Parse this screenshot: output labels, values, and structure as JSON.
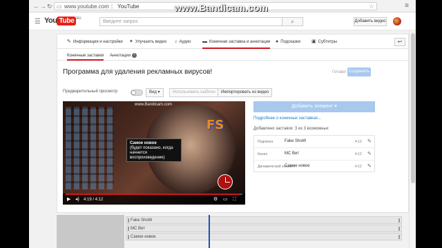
{
  "watermark": "www.Bandicam.com",
  "browser": {
    "url": "www.youtube.com",
    "page_title": "YouTube"
  },
  "header": {
    "logo_you": "You",
    "logo_tube": "Tube",
    "logo_region": "RU",
    "search_placeholder": "Введите запрос",
    "upload_label": "Добавить видео"
  },
  "tabs": [
    {
      "label": "Информация и настройки",
      "icon": "pencil-icon"
    },
    {
      "label": "Улучшить видео",
      "icon": "magic-wand-icon"
    },
    {
      "label": "Аудио",
      "icon": "music-note-icon"
    },
    {
      "label": "Конечная заставка и аннотации",
      "icon": "end-screen-icon",
      "active": true
    },
    {
      "label": "Подсказки",
      "icon": "info-icon"
    },
    {
      "label": "Субтитры",
      "icon": "subtitles-icon"
    }
  ],
  "subtabs": [
    {
      "label": "Конечные заставки",
      "active": true
    },
    {
      "label": "Аннотации",
      "badge": "!"
    }
  ],
  "video_title": "Программа для удаления рекламных вирусов!",
  "status_ready": "Готово!",
  "save_label": "Сохранить",
  "toolbar": {
    "preview_label": "Предварительный просмотр",
    "view_label": "Вид ▾",
    "template_label": "Использовать шаблон",
    "import_label": "Импортировать из видео"
  },
  "video": {
    "watermark": "www.Bandicam.com",
    "tooltip_title": "Самое новое",
    "tooltip_text": "(будет показано, когда начнется воспроизведение)",
    "logo_text": "FS",
    "time": "4:19 / 4:12",
    "progress": 0.98
  },
  "add_element_label": "Добавить элемент ▾",
  "more_link": "Подробнее о конечных заставках...",
  "added_count": "Добавлено заставок: 3 из 3 возможных",
  "elements": [
    {
      "type": "Подписка",
      "name": "Fake ShoW",
      "duration": "4:12"
    },
    {
      "type": "Канал",
      "name": "MC Вит",
      "duration": "4:12"
    },
    {
      "type": "Динамический элемент",
      "name": "Самое новое",
      "duration": "4:12"
    }
  ],
  "timeline": [
    {
      "label": "Fake ShoW"
    },
    {
      "label": "MC Вит"
    },
    {
      "label": "Самое новое"
    }
  ]
}
